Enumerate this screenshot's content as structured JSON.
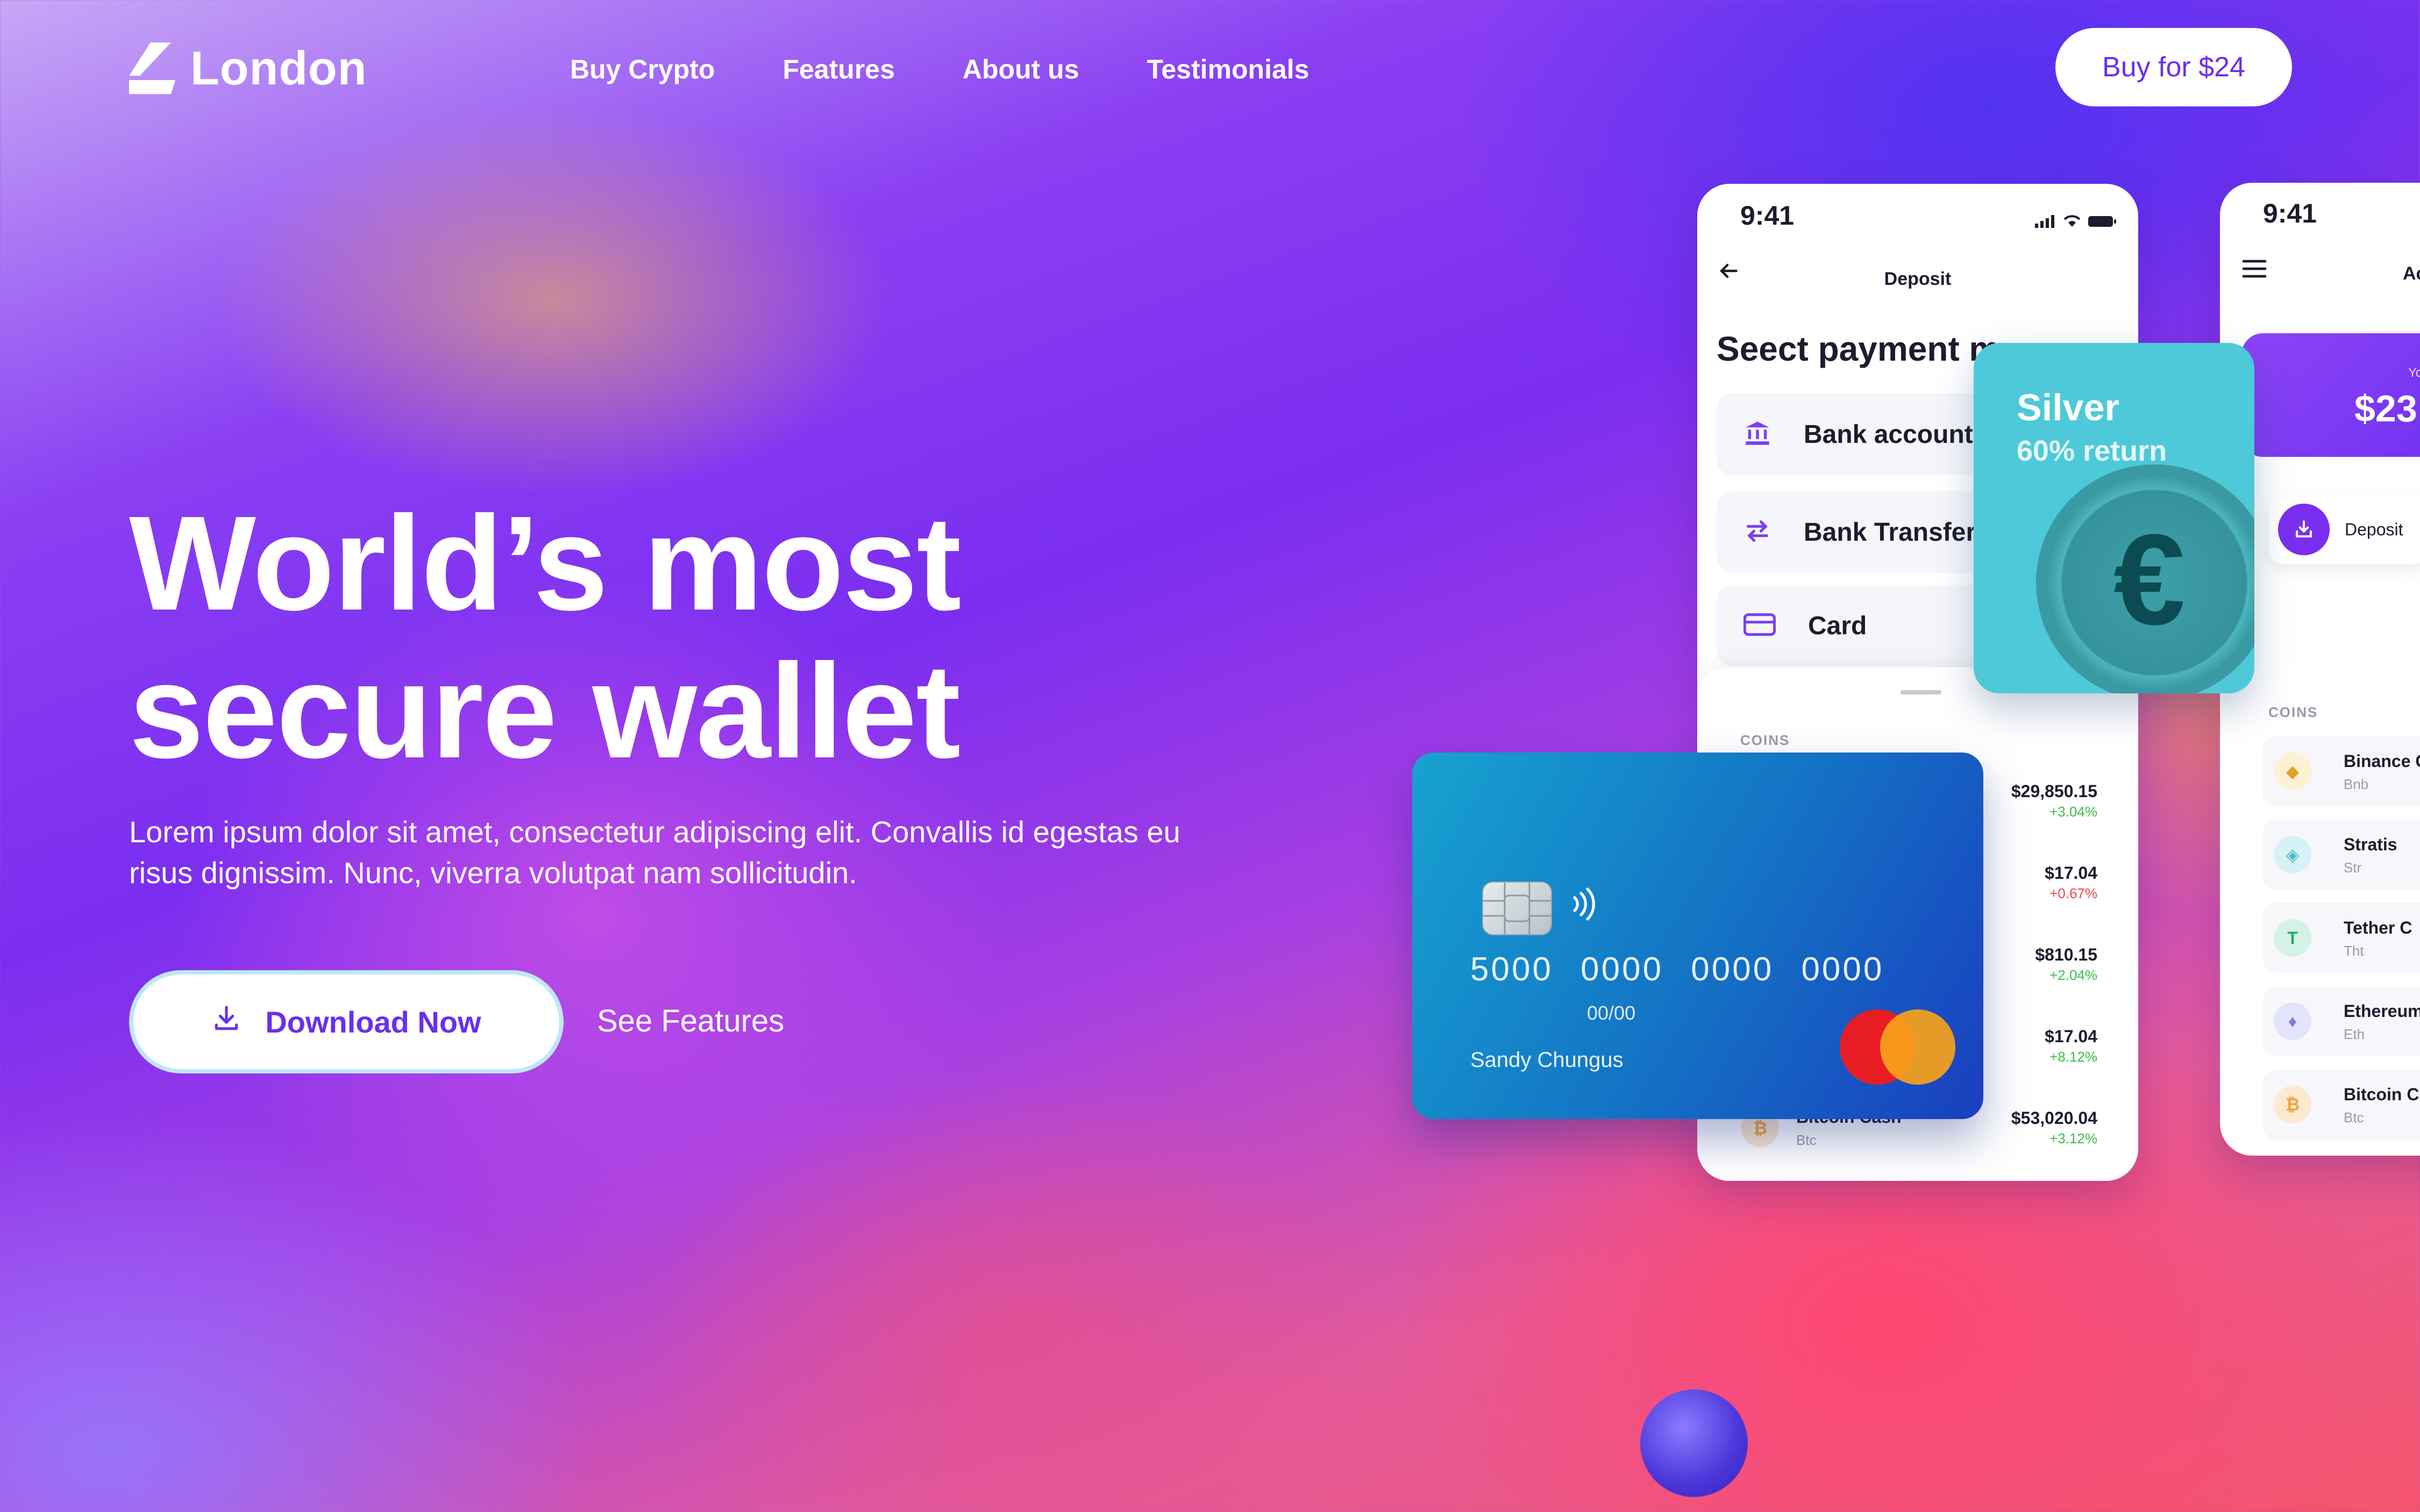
{
  "brand": {
    "name": "London"
  },
  "nav": {
    "items": [
      "Buy Crypto",
      "Features",
      "About us",
      "Testimonials"
    ]
  },
  "buy_button": "Buy for $24",
  "hero": {
    "title_line1": "World’s most",
    "title_line2": "secure wallet",
    "subtitle": "Lorem ipsum dolor sit amet, consectetur adipiscing elit. Convallis id egestas eu risus dignissim. Nunc, viverra volutpat nam sollicitudin.",
    "download_label": "Download Now",
    "features_label": "See Features"
  },
  "phone1": {
    "time": "9:41",
    "heading": "Deposit",
    "subtitle": "Seect payment m",
    "options": [
      "Bank account",
      "Bank Transfer",
      "Card"
    ],
    "coins_label": "COINS",
    "coins": [
      {
        "name": "",
        "symbol": "",
        "price": "$29,850.15",
        "change": "+3.04%"
      },
      {
        "name": "",
        "symbol": "",
        "price": "$17.04",
        "change": "+0.67%"
      },
      {
        "name": "",
        "symbol": "",
        "price": "$810.15",
        "change": "+2.04%"
      },
      {
        "name": "",
        "symbol": "",
        "price": "$17.04",
        "change": "+8.12%"
      },
      {
        "name": "Bitcoin Cash",
        "symbol": "Btc",
        "price": "$53,020.04",
        "change": "+3.12%"
      }
    ]
  },
  "phone2": {
    "time": "9:41",
    "heading": "Ac",
    "balance_label": "Your",
    "balance": "$23",
    "deposit_label": "Deposit",
    "coins_label": "COINS",
    "coins": [
      {
        "name": "Binance C",
        "symbol": "Bnb"
      },
      {
        "name": "Stratis",
        "symbol": "Str"
      },
      {
        "name": "Tether C",
        "symbol": "Tht"
      },
      {
        "name": "Ethereum",
        "symbol": "Eth"
      },
      {
        "name": "Bitcoin C",
        "symbol": "Btc"
      }
    ]
  },
  "silver_card": {
    "title": "Silver",
    "subtitle": "60% return",
    "symbol": "€"
  },
  "credit_card": {
    "number": "5000 0000 0000 0000",
    "valid": "00/00",
    "holder": "Sandy Chungus"
  },
  "colors": {
    "accent": "#6a2ef0",
    "positive": "#3bbf4a",
    "negative": "#e84b4b"
  }
}
